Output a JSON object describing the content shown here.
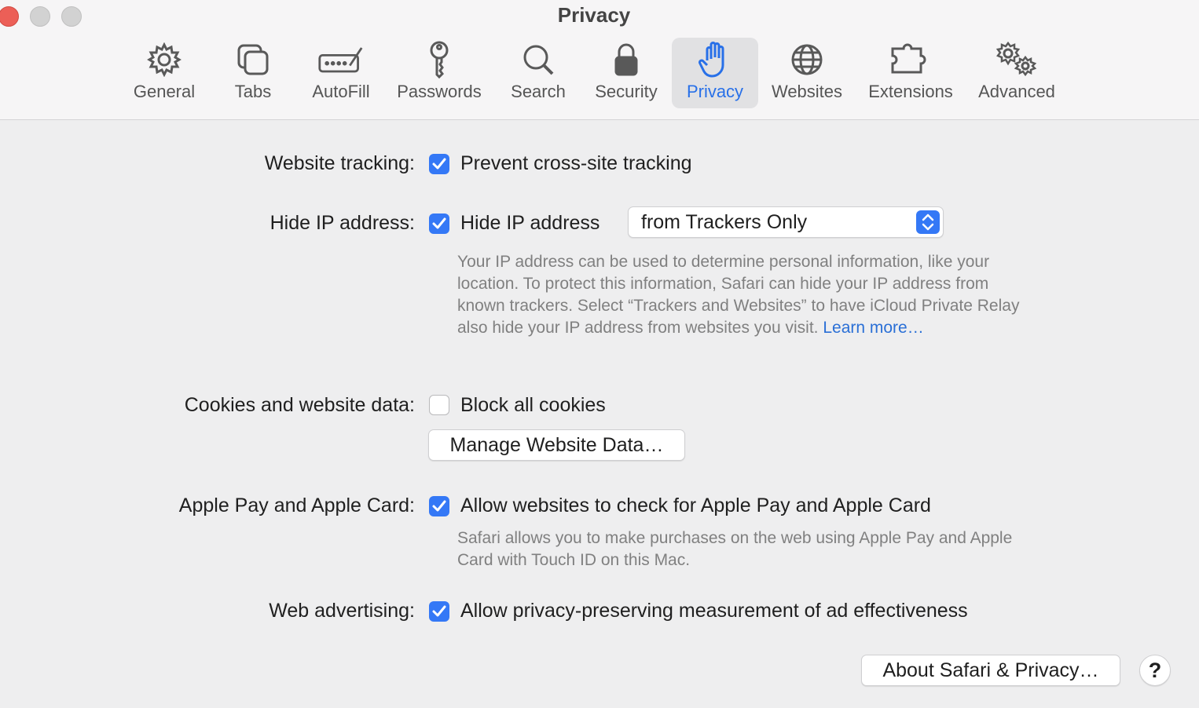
{
  "window": {
    "title": "Privacy"
  },
  "toolbar": {
    "items": [
      {
        "label": "General",
        "icon": "gear-icon"
      },
      {
        "label": "Tabs",
        "icon": "tabs-icon"
      },
      {
        "label": "AutoFill",
        "icon": "autofill-icon"
      },
      {
        "label": "Passwords",
        "icon": "key-icon"
      },
      {
        "label": "Search",
        "icon": "search-icon"
      },
      {
        "label": "Security",
        "icon": "lock-icon"
      },
      {
        "label": "Privacy",
        "icon": "hand-icon",
        "selected": true
      },
      {
        "label": "Websites",
        "icon": "globe-icon"
      },
      {
        "label": "Extensions",
        "icon": "puzzle-icon"
      },
      {
        "label": "Advanced",
        "icon": "gears-icon"
      }
    ]
  },
  "settings": {
    "website_tracking": {
      "label": "Website tracking:",
      "checkbox": "Prevent cross-site tracking",
      "checked": true
    },
    "hide_ip": {
      "label": "Hide IP address:",
      "checkbox": "Hide IP address",
      "checked": true,
      "select_value": "from Trackers Only",
      "description": "Your IP address can be used to determine personal information, like your location. To protect this information, Safari can hide your IP address from known trackers. Select “Trackers and Websites” to have iCloud Private Relay also hide your IP address from websites you visit.",
      "learn_more": "Learn more…"
    },
    "cookies": {
      "label": "Cookies and website data:",
      "checkbox": "Block all cookies",
      "checked": false,
      "manage_button": "Manage Website Data…"
    },
    "apple_pay": {
      "label": "Apple Pay and Apple Card:",
      "checkbox": "Allow websites to check for Apple Pay and Apple Card",
      "checked": true,
      "description": "Safari allows you to make purchases on the web using Apple Pay and Apple Card with Touch ID on this Mac."
    },
    "web_advertising": {
      "label": "Web advertising:",
      "checkbox": "Allow privacy-preserving measurement of ad effectiveness",
      "checked": true
    }
  },
  "footer": {
    "about_button": "About Safari & Privacy…",
    "help_button": "?"
  },
  "colors": {
    "accent": "#3478f6",
    "close": "#ec5f57"
  }
}
